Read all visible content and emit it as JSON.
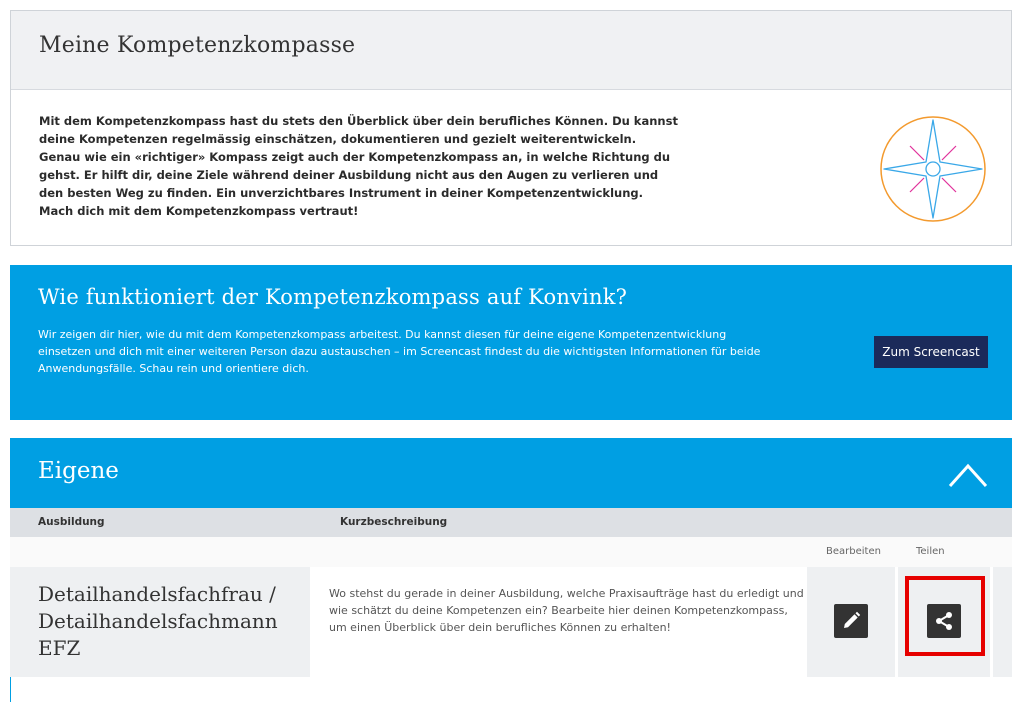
{
  "intro": {
    "title": "Meine Kompetenzkompasse",
    "text": "Mit dem Kompetenzkompass hast du stets den Überblick über dein berufliches Können. Du kannst deine Kompetenzen regelmässig einschätzen, dokumentieren und gezielt weiterentwickeln. Genau wie ein «richtiger» Kompass zeigt auch der Kompetenzkompass an, in welche Richtung du gehst. Er hilft dir, deine Ziele während deiner Ausbildung nicht aus den Augen zu verlieren und den besten Weg zu finden. Ein unverzichtbares Instrument in deiner Kompetenzentwicklung. Mach dich mit dem Kompetenzkompass vertraut!",
    "illustration": "compass-icon"
  },
  "info": {
    "title": "Wie funktioniert der Kompetenzkompass auf Konvink?",
    "text": "Wir zeigen dir hier, wie du mit dem Kompetenzkompass arbeitest. Du kannst diesen für deine eigene Kompetenzentwicklung einsetzen und dich mit einer weiteren Person dazu austauschen – im Screencast findest du die wichtigsten Informationen für beide Anwendungsfälle. Schau rein und orientiere dich.",
    "button_label": "Zum Screencast"
  },
  "section": {
    "title": "Eigene",
    "collapse_icon": "chevron-up-icon",
    "columns": [
      "Ausbildung",
      "Kurzbeschreibung"
    ],
    "action_labels": [
      "Bearbeiten",
      "Teilen"
    ],
    "rows": [
      {
        "title": "Detailhandelsfachfrau / Detailhandelsfachmann EFZ",
        "description": "Wo stehst du gerade in deiner Ausbildung, welche Praxisaufträge hast du erledigt und wie schätzt du deine Kompetenzen ein? Bearbeite hier deinen Kompetenzkompass, um einen Überblick über dein berufliches Können zu erhalten!",
        "edit_icon": "pencil-icon",
        "share_icon": "share-icon"
      }
    ]
  },
  "colors": {
    "accent": "#009fe3",
    "button_dark": "#1b2a5a",
    "highlight": "#e60000",
    "compass_ring": "#f39a2e",
    "compass_star": "#3aa8e8",
    "compass_lines": "#e0329a"
  }
}
